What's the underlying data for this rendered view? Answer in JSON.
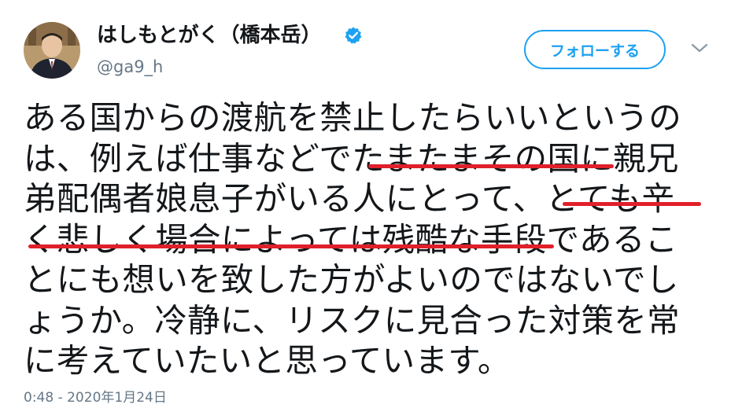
{
  "tweet": {
    "display_name": "はしもとがく（橋本岳）",
    "handle": "@ga9_h",
    "follow_label": "フォローする",
    "text_lines": [
      "ある国からの渡航を禁止したらいいというの",
      "は、例えば仕事などでたまたまその国に親兄",
      "弟配偶者娘息子がいる人にとって、とても辛",
      "く悲しく場合によっては残酷な手段であるこ",
      "とにも想いを致した方がよいのではないでし",
      "ょうか。冷静に、リスクに見合った対策を常",
      "に考えていたいと思っています。"
    ],
    "timestamp": "0:48 - 2020年1月24日"
  },
  "icons": {
    "verified": "verified-badge-icon",
    "more": "chevron-down-icon"
  },
  "colors": {
    "accent": "#1da1f2",
    "text": "#14171a",
    "secondary": "#657786",
    "underline": "#e0202a"
  }
}
